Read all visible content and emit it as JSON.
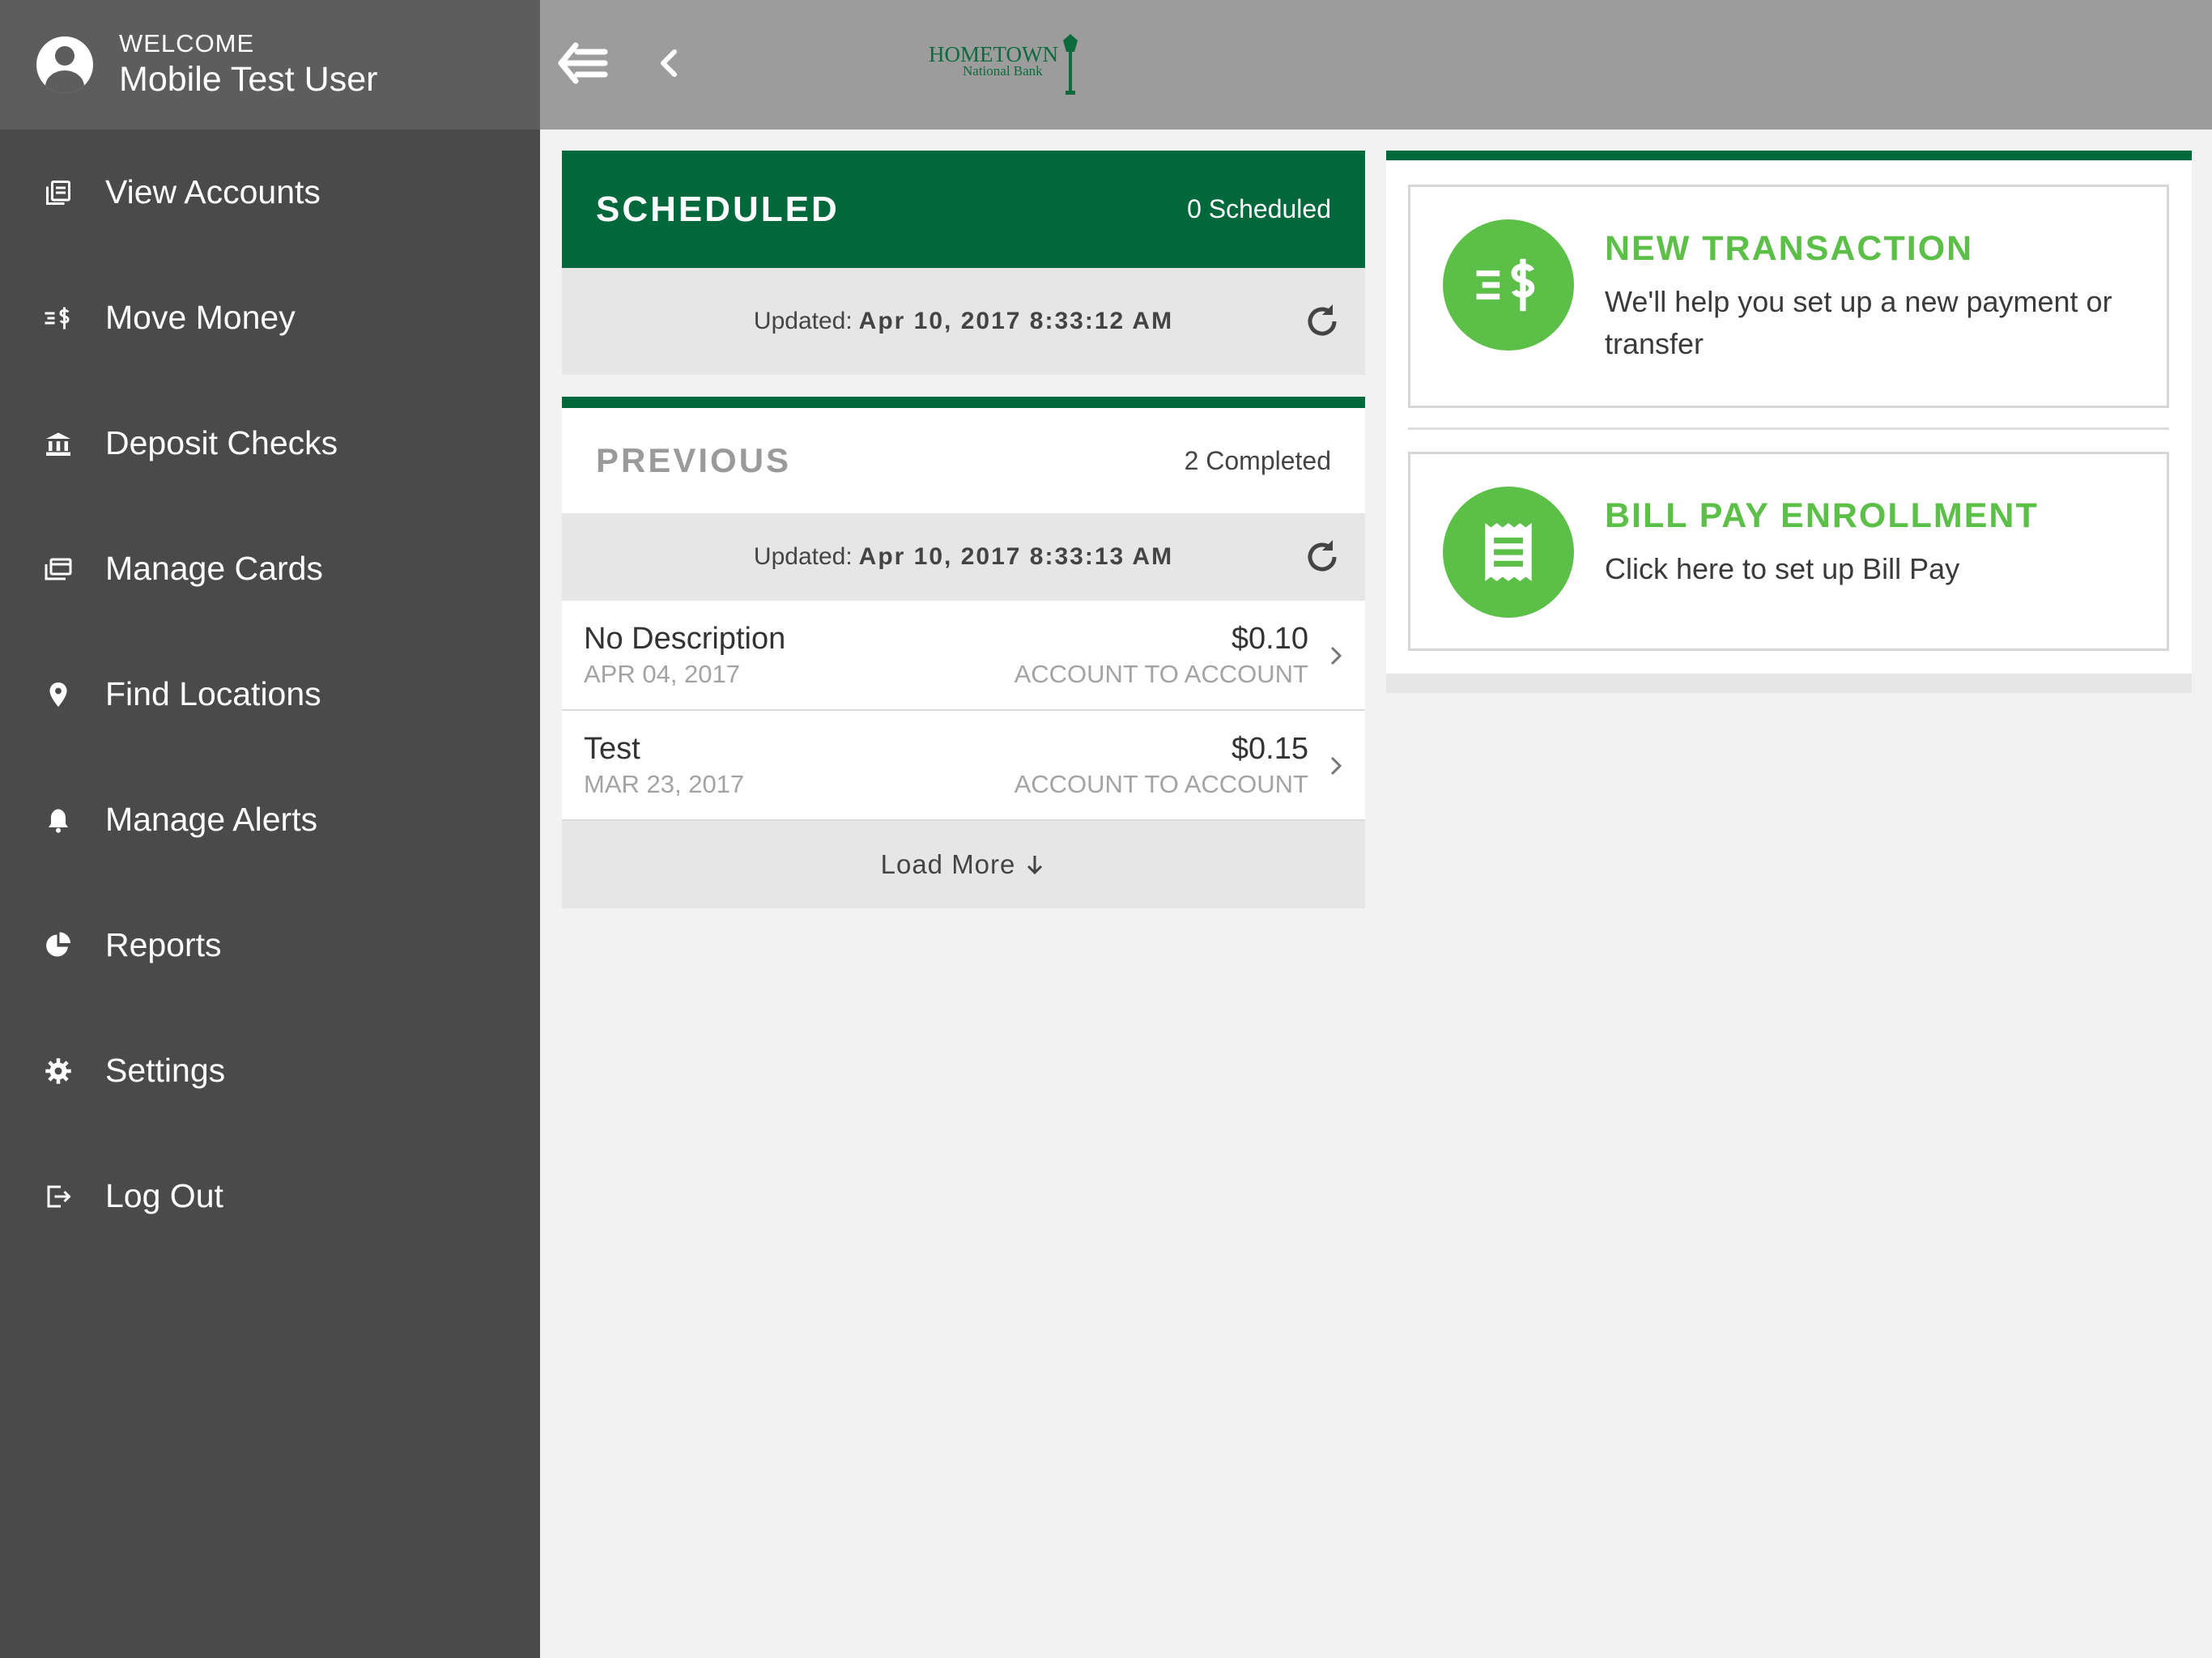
{
  "sidebar": {
    "welcome_label": "WELCOME",
    "user_name": "Mobile Test User",
    "items": [
      {
        "label": "View Accounts",
        "icon": "accounts-icon"
      },
      {
        "label": "Move Money",
        "icon": "transfer-money-icon"
      },
      {
        "label": "Deposit Checks",
        "icon": "bank-icon"
      },
      {
        "label": "Manage Cards",
        "icon": "cards-icon"
      },
      {
        "label": "Find Locations",
        "icon": "location-pin-icon"
      },
      {
        "label": "Manage Alerts",
        "icon": "bell-icon"
      },
      {
        "label": "Reports",
        "icon": "pie-chart-icon"
      },
      {
        "label": "Settings",
        "icon": "gear-icon"
      },
      {
        "label": "Log Out",
        "icon": "logout-icon"
      }
    ]
  },
  "header": {
    "logo_line1": "HOMETOWN",
    "logo_line2": "National Bank"
  },
  "scheduled": {
    "title": "SCHEDULED",
    "count": "0 Scheduled",
    "updated_label": "Updated:",
    "updated_value": "Apr 10, 2017 8:33:12 AM"
  },
  "previous": {
    "title": "PREVIOUS",
    "count": "2 Completed",
    "updated_label": "Updated:",
    "updated_value": "Apr 10, 2017 8:33:13 AM",
    "transactions": [
      {
        "description": "No Description",
        "date": "APR 04, 2017",
        "amount": "$0.10",
        "type": "ACCOUNT TO ACCOUNT"
      },
      {
        "description": "Test",
        "date": "MAR 23, 2017",
        "amount": "$0.15",
        "type": "ACCOUNT TO ACCOUNT"
      }
    ],
    "load_more": "Load More"
  },
  "actions": {
    "new_transaction": {
      "title": "NEW TRANSACTION",
      "description": "We'll help you set up a new payment or transfer"
    },
    "bill_pay": {
      "title": "BILL PAY ENROLLMENT",
      "description": "Click here to set up Bill Pay"
    }
  },
  "colors": {
    "brand_green": "#00683b",
    "accent_green": "#5cbf48",
    "sidebar_bg": "#4a4a4a",
    "topbar_bg": "#9c9c9c"
  }
}
